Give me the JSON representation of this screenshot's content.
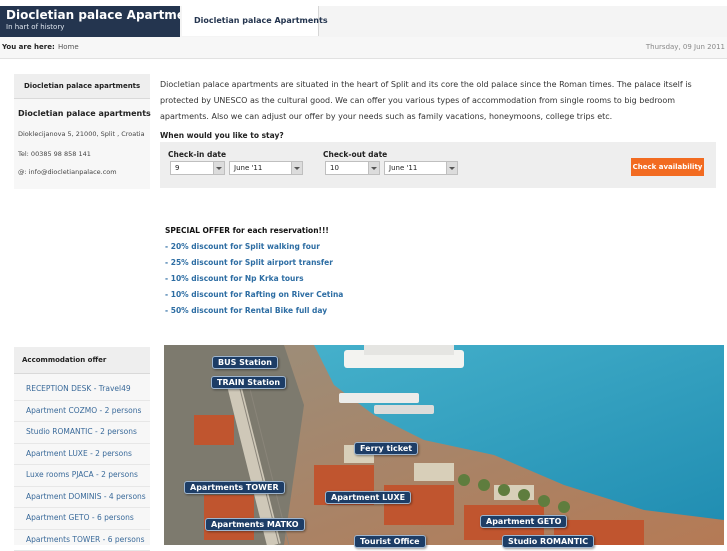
{
  "site": {
    "title": "Diocletian palace Apartments",
    "tagline": "In hart of history"
  },
  "nav": {
    "tab_label": "Diocletian palace Apartments"
  },
  "breadcrumb": {
    "label": "You are here:",
    "home": "Home",
    "date": "Thursday, 09 Jun 2011"
  },
  "contact": {
    "header": "Diocletian palace apartments",
    "name": "Diocletian palace apartments",
    "address": "Dioklecijanova 5, 21000, Split , Croatia",
    "phone": "Tel: 00385 98 858 141",
    "email": "@: info@diocletianpalace.com"
  },
  "intro": {
    "text": "Diocletian palace apartments are situated in the heart of Split and its core the old palace since the Roman times. The palace itself is protected by UNESCO as the cultural good. We can offer you various types of accommodation from single rooms to big bedroom apartments. Also we can adjust our offer by your needs such as family vacations, honeymoons, college trips etc."
  },
  "booking": {
    "question": "When would you like to stay?",
    "checkin_label": "Check-in date",
    "checkin_day": "9",
    "checkin_month": "June '11",
    "checkout_label": "Check-out date",
    "checkout_day": "10",
    "checkout_month": "June '11",
    "button": "Check availability"
  },
  "offers": {
    "title": "SPECIAL OFFER for each reservation!!!",
    "items": [
      "- 20% discount for Split walking four",
      "- 25% discount for Split airport transfer",
      "- 10% discount for Np Krka tours",
      "- 10% discount for Rafting on River Cetina",
      "- 50% discount for Rental Bike full day"
    ]
  },
  "accommodation": {
    "header": "Accommodation offer",
    "items": [
      "RECEPTION DESK - Travel49",
      "Apartment COZMO - 2 persons",
      "Studio ROMANTIC - 2 persons",
      "Apartment LUXE - 2 persons",
      "Luxe rooms PJACA - 2 persons",
      "Apartment DOMINIS - 4 persons",
      "Apartment GETO - 6 persons",
      "Apartments TOWER - 6 persons"
    ]
  },
  "map": {
    "labels": {
      "bus": "BUS Station",
      "train": "TRAIN Station",
      "ferry": "Ferry ticket",
      "tower": "Apartments TOWER",
      "luxe": "Apartment LUXE",
      "matko": "Apartments MATKO",
      "geto": "Apartment GETO",
      "tourist": "Tourist Office",
      "romantic": "Studio ROMANTIC"
    }
  },
  "colors": {
    "brand_dark": "#24354f",
    "accent_orange": "#f26b21",
    "link_blue": "#2d6da3",
    "sea": "#3fa8c7"
  }
}
